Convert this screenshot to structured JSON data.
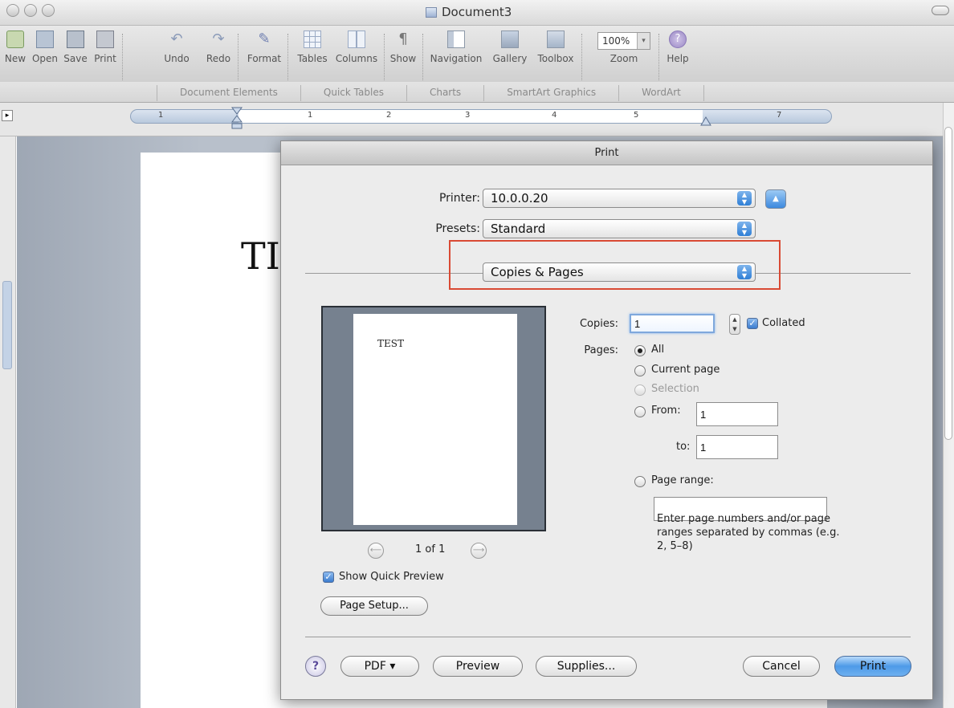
{
  "window": {
    "title": "Document3"
  },
  "toolbar": {
    "new": "New",
    "open": "Open",
    "save": "Save",
    "print": "Print",
    "undo": "Undo",
    "redo": "Redo",
    "format": "Format",
    "tables": "Tables",
    "columns": "Columns",
    "show": "Show",
    "navigation": "Navigation",
    "gallery": "Gallery",
    "toolbox": "Toolbox",
    "zoom_value": "100%",
    "zoom": "Zoom",
    "help": "Help"
  },
  "ribbon": {
    "tabs": [
      "Document Elements",
      "Quick Tables",
      "Charts",
      "SmartArt Graphics",
      "WordArt"
    ]
  },
  "ruler": {
    "numbers": [
      "1",
      "1",
      "2",
      "3",
      "4",
      "5",
      "7"
    ]
  },
  "document": {
    "text": "TI"
  },
  "print_dialog": {
    "title": "Print",
    "printer_label": "Printer:",
    "printer_value": "10.0.0.20",
    "presets_label": "Presets:",
    "presets_value": "Standard",
    "panel_value": "Copies & Pages",
    "preview_text": "TEST",
    "page_count": "1 of 1",
    "show_quick_preview": "Show Quick Preview",
    "page_setup": "Page Setup...",
    "copies_label": "Copies:",
    "copies_value": "1",
    "collated": "Collated",
    "pages_label": "Pages:",
    "option_all": "All",
    "option_current": "Current page",
    "option_selection": "Selection",
    "option_from": "From:",
    "from_value": "1",
    "to_label": "to:",
    "to_value": "1",
    "option_range": "Page range:",
    "range_value": "",
    "range_hint": "Enter page numbers and/or page ranges separated by commas (e.g. 2, 5–8)",
    "help": "?",
    "pdf": "PDF ▾",
    "preview": "Preview",
    "supplies": "Supplies...",
    "cancel": "Cancel",
    "print": "Print"
  },
  "colors": {
    "highlight_box": "#d94a34",
    "default_button": "#4e9ae8",
    "preview_frame": "#76818f"
  }
}
